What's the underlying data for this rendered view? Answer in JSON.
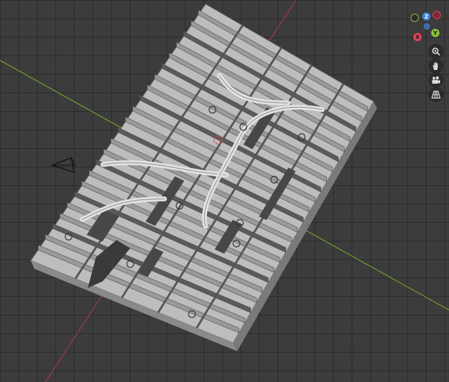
{
  "app": "3D viewport",
  "gizmo": {
    "x_label": "X",
    "y_label": "Y",
    "z_label": "Z",
    "x_color": "#e5435b",
    "y_color": "#8bc33a",
    "z_color": "#3e7fd8"
  },
  "toolbar": {
    "zoom_icon": "zoom-icon",
    "pan_icon": "hand-icon",
    "camera_icon": "camera-icon",
    "ortho_icon": "grid-perspective-icon"
  },
  "colors": {
    "background": "#3c3c3c",
    "x_axis_line": "#a0383f",
    "y_axis_line": "#6f9a2b",
    "model": "#c9c9c9"
  }
}
